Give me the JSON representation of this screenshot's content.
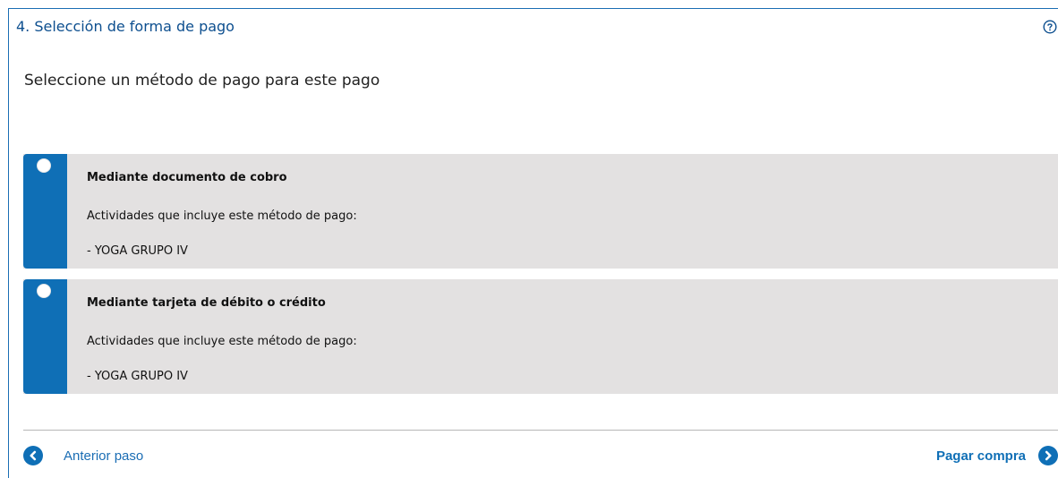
{
  "step": {
    "title": "4. Selección de forma de pago"
  },
  "subtitle": "Seleccione un método de pago para este pago",
  "options": [
    {
      "title": "Mediante documento de cobro",
      "description": "Actividades que incluye este método de pago:",
      "item": "- YOGA GRUPO IV"
    },
    {
      "title": "Mediante tarjeta de débito o crédito",
      "description": "Actividades que incluye este método de pago:",
      "item": "- YOGA GRUPO IV"
    }
  ],
  "nav": {
    "prev_label": "Anterior paso",
    "next_label": "Pagar compra"
  },
  "colors": {
    "accent": "#0f6fb6",
    "title": "#0d4f8f",
    "option_bg": "#e3e1e1"
  },
  "icons": {
    "help": "help-icon",
    "prev": "chevron-left-circle-icon",
    "next": "chevron-right-circle-icon"
  }
}
